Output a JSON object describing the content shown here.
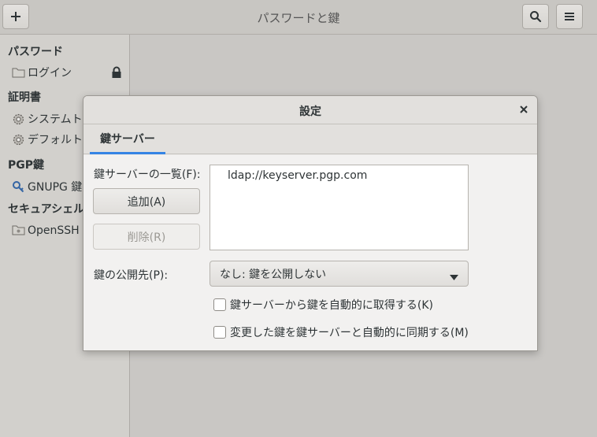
{
  "window": {
    "title": "パスワードと鍵"
  },
  "header": {
    "add_icon": "plus-icon",
    "search_icon": "search-icon",
    "menu_icon": "hamburger-menu-icon"
  },
  "sidebar": {
    "sections": [
      {
        "heading": "パスワード",
        "items": [
          {
            "label": "ログイン",
            "icon": "folder-icon",
            "locked": true
          }
        ]
      },
      {
        "heading": "証明書",
        "items": [
          {
            "label": "システムト",
            "icon": "gear-icon"
          },
          {
            "label": "デフォルト",
            "icon": "gear-icon"
          }
        ]
      },
      {
        "heading": "PGP鍵",
        "items": [
          {
            "label": "GNUPG 鍵",
            "icon": "key-icon"
          }
        ]
      },
      {
        "heading": "セキュアシェル",
        "items": [
          {
            "label": "OpenSSH 鍵",
            "icon": "folder-icon"
          }
        ]
      }
    ]
  },
  "dialog": {
    "title": "設定",
    "close_icon": "close-icon",
    "tabs": [
      {
        "label": "鍵サーバー",
        "active": true
      }
    ],
    "keyserver_list_label": "鍵サーバーの一覧(F):",
    "keyservers": [
      "ldap://keyserver.pgp.com"
    ],
    "add_button": "追加(A)",
    "remove_button": "削除(R)",
    "publish_label": "鍵の公開先(P):",
    "publish_selected": "なし: 鍵を公開しない",
    "auto_retrieve_label": "鍵サーバーから鍵を自動的に取得する(K)",
    "auto_retrieve_checked": false,
    "auto_sync_label": "変更した鍵を鍵サーバーと自動的に同期する(M)",
    "auto_sync_checked": false
  },
  "colors": {
    "accent": "#3584e4",
    "sidebar_bg": "#d2d0cc",
    "dialog_bg": "#f2f1f0"
  }
}
